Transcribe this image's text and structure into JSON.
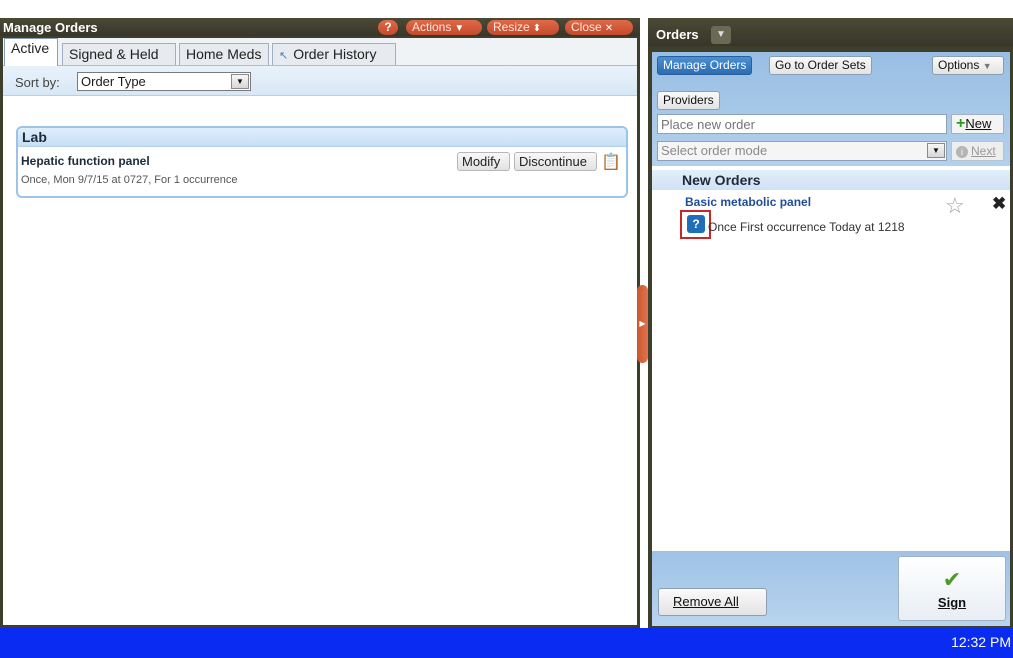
{
  "left": {
    "title": "Manage Orders",
    "help_label": "?",
    "actions_label": "Actions",
    "resize_label": "Resize",
    "close_label": "Close",
    "tabs": [
      {
        "label": "Active"
      },
      {
        "label": "Signed & Held"
      },
      {
        "label": "Home Meds"
      },
      {
        "label": "Order History"
      }
    ],
    "sort_label": "Sort by:",
    "sort_value": "Order Type",
    "group": {
      "title": "Lab",
      "order_name": "Hepatic function panel",
      "order_detail": "Once, Mon 9/7/15 at 0727, For 1 occurrence",
      "modify_label": "Modify",
      "discontinue_label": "Discontinue"
    }
  },
  "right": {
    "title": "Orders",
    "manage_orders_label": "Manage Orders",
    "order_sets_label": "Go to Order Sets",
    "options_label": "Options",
    "providers_label": "Providers",
    "place_order_placeholder": "Place new order",
    "new_label": "New",
    "order_mode_placeholder": "Select order mode",
    "next_label": "Next",
    "new_orders_heading": "New Orders",
    "new_order": {
      "name": "Basic metabolic panel",
      "detail": "Once First occurrence Today at 1218"
    },
    "remove_all_label": "Remove All",
    "sign_label": "Sign"
  },
  "taskbar": {
    "clock": "12:32 PM"
  }
}
